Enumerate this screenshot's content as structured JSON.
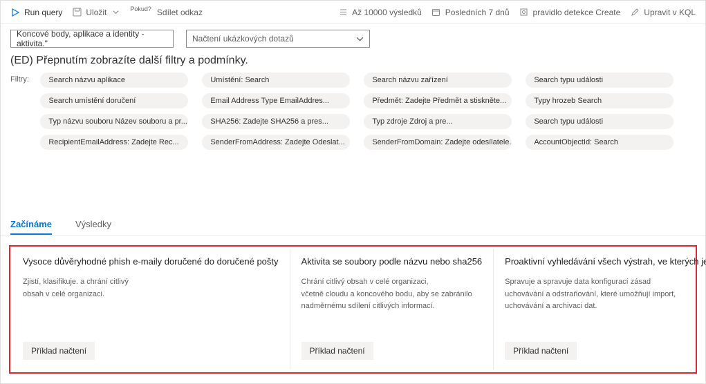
{
  "toolbar": {
    "run_query": "Run query",
    "save": "Uložit",
    "share_sup": "Pokud?",
    "share": "Sdílet odkaz",
    "results_limit": "Až 10000 výsledků",
    "time_range": "Posledních 7 dnů",
    "detection_rule": "pravidlo detekce Create",
    "edit_kql": "Upravit v KQL"
  },
  "query_row": {
    "query_text": "Koncové body, aplikace a identity - aktivita.\"",
    "sample_dropdown": "Načtení ukázkových dotazů"
  },
  "subtitle": "(ED) Přepnutím zobrazíte další filtry a podmínky.",
  "filters_label": "Filtry:",
  "filters": [
    [
      "Search názvu aplikace",
      "Umístění: Search",
      "Search názvu zařízení",
      "Search typu události"
    ],
    [
      "Search umístění doručení",
      "Email Address Type EmailAddres...",
      "Předmět: Zadejte Předmět a stiskněte...",
      "Typy hrozeb Search"
    ],
    [
      "Typ názvu souboru Název souboru a pr...",
      "SHA256: Zadejte SHA256 a pres...",
      "Typ zdroje Zdroj a pre...",
      "Search typu události"
    ],
    [
      "RecipientEmailAddress: Zadejte Rec...",
      "SenderFromAddress: Zadejte Odeslat...",
      "SenderFromDomain: Zadejte odesílatele.",
      "AccountObjectId: Search"
    ]
  ],
  "tabs": {
    "getting_started": "Začínáme",
    "results": "Výsledky"
  },
  "cards": [
    {
      "title": "Vysoce důvěryhodné phish e-maily doručené do doručené pošty",
      "desc": "Zjistí, klasifikuje. a chrání citlivý\nobsah v celé organizaci.",
      "button": "Příklad načtení"
    },
    {
      "title": "Aktivita se soubory podle názvu nebo sha256",
      "desc": "Chrání citlivý obsah v celé organizaci,\nvčetně cloudu a koncového bodu, aby se zabránilo\nnadměrnému sdílení citlivých informací.",
      "button": "Příklad načtení"
    },
    {
      "title": "Proaktivní vyhledávání všech výstrah, ve kterých je uživatel X",
      "desc": "Spravuje a spravuje data konfigurací zásad\nuchovávání a odstraňování, které umožňují import,\nuchovávání a archivaci dat.",
      "button": "Příklad načtení"
    }
  ]
}
